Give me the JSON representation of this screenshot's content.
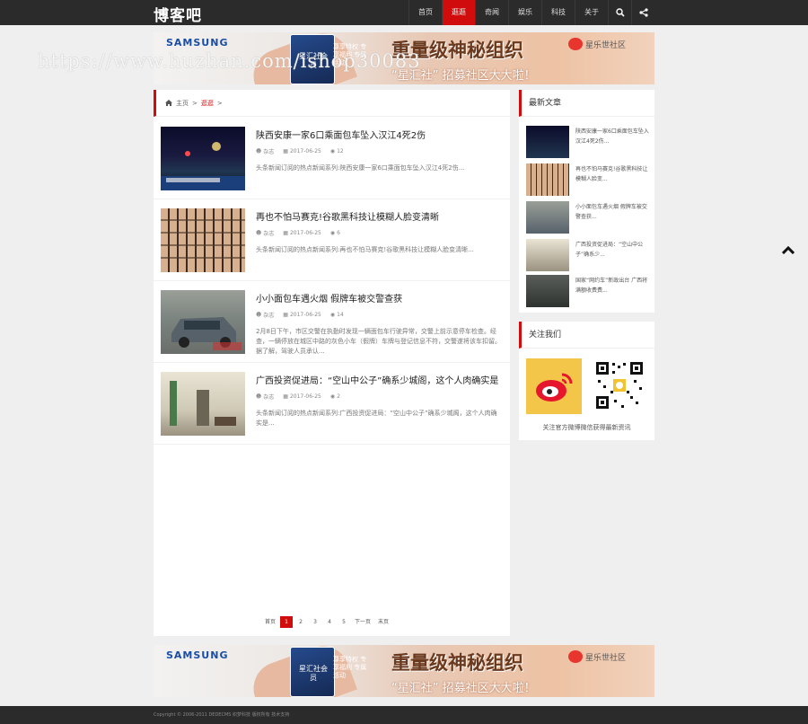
{
  "header": {
    "logo": "博客吧",
    "nav": [
      {
        "label": "首页",
        "active": false
      },
      {
        "label": "逛逛",
        "active": true
      },
      {
        "label": "奇闻",
        "active": false
      },
      {
        "label": "娱乐",
        "active": false
      },
      {
        "label": "科技",
        "active": false
      },
      {
        "label": "关于",
        "active": false
      }
    ],
    "icons": [
      "search-icon",
      "share-icon"
    ]
  },
  "banner": {
    "brand": "SAMSUNG",
    "card_text": "星汇社会员",
    "promo": "尊享特权 专享福利 专属活动",
    "headline": "重量级神秘组织",
    "sub": "“星汇社” 招募社区大大啦！",
    "partner": "星乐世社区"
  },
  "watermark": "https://www.huzhan.com/ishop30083",
  "breadcrumb": {
    "home": "主页",
    "sep": ">",
    "current": "逛逛",
    "trail": ">"
  },
  "articles": [
    {
      "title": "陕西安康一家6口乘面包车坠入汉江4死2伤",
      "author": "杂志",
      "date": "2017-06-25",
      "views": "12",
      "desc": "头条新闻订阅的热点新闻系列:陕西安康一家6口乘面包车坠入汉江4死2伤..."
    },
    {
      "title": "再也不怕马赛克!谷歌黑科技让模糊人脸变清晰",
      "author": "杂志",
      "date": "2017-06-25",
      "views": "6",
      "desc": "头条新闻订阅的热点新闻系列:再也不怕马赛克!谷歌黑科技让模糊人脸变清晰..."
    },
    {
      "title": "小小面包车遇火烟 假牌车被交警查获",
      "author": "杂志",
      "date": "2017-06-25",
      "views": "14",
      "desc": "2月8日下午，市区交警在执勤时发现一辆面包车行驶异常，交警上前示意停车检查。经查，一辆停放在城区中路的灰色小车（假牌）车牌与登记信息不符，交警遂将该车扣留。据了解，驾驶人员承认..."
    },
    {
      "title": "广西投资促进局：“空山中公子”确系少城阁，这个人肉确实是",
      "author": "杂志",
      "date": "2017-06-25",
      "views": "2",
      "desc": "头条新闻订阅的热点新闻系列:广西投资促进局：“空山中公子”确系少城阁，这个人肉确实是..."
    }
  ],
  "pagination": [
    "首页",
    "1",
    "2",
    "3",
    "4",
    "5",
    "下一页",
    "末页"
  ],
  "sidebar": {
    "latest_title": "最新文章",
    "latest": [
      "陕西安康一家6口乘面包车坠入汉江4死2伤...",
      "再也不怕马赛克!谷歌黑科技让模糊人脸变...",
      "小小面包车遇火烟 假牌车被交警查获...",
      "广西投资促进局：“空山中公子”确系少...",
      "国家“网约车”新政出台 广西将 满额收费费..."
    ],
    "follow_title": "关注我们",
    "follow_caption": "关注官方微博微信获得最新资讯"
  },
  "footer": {
    "copyright": "Copyright © 2006-2011 DEDECMS 织梦科技 版权所有 技术支持"
  }
}
